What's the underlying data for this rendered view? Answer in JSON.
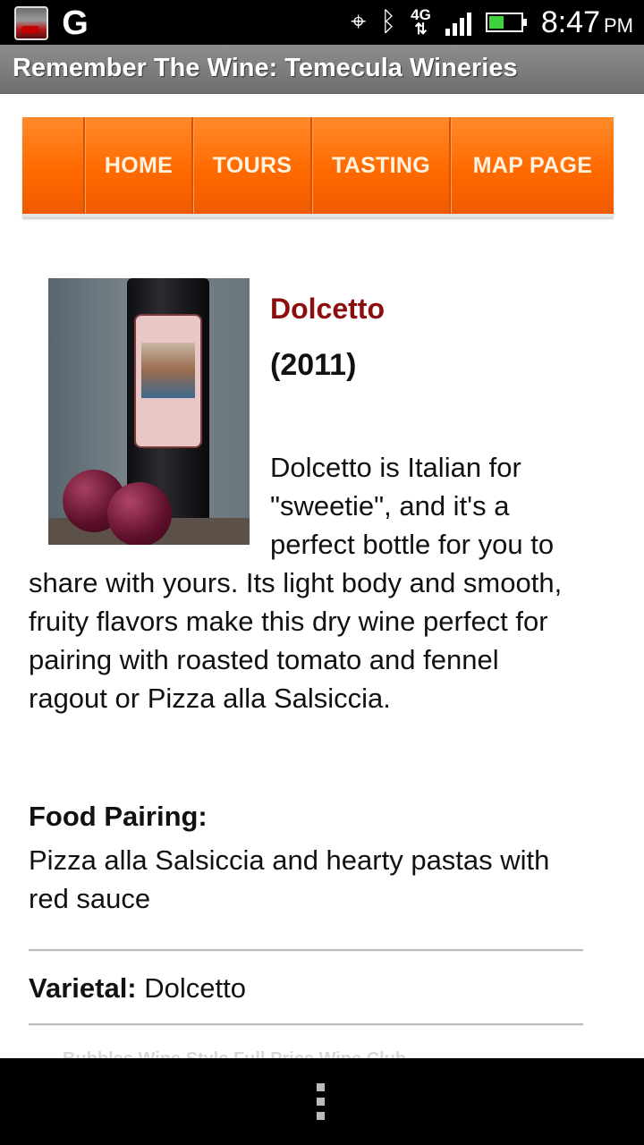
{
  "status_bar": {
    "time": "8:47",
    "ampm": "PM",
    "network": "4G",
    "icons": [
      "photo-notification-icon",
      "google-icon",
      "gps-icon",
      "bluetooth-icon",
      "network-4g-icon",
      "signal-icon",
      "battery-icon"
    ],
    "google_glyph": "G"
  },
  "app": {
    "title": "Remember The Wine: Temecula Wineries"
  },
  "nav": {
    "items": [
      {
        "label": "HOME"
      },
      {
        "label": "TOURS"
      },
      {
        "label": "TASTING"
      },
      {
        "label": "MAP PAGE"
      }
    ],
    "colors": {
      "background": "#ff6a00",
      "text": "#fff3e0"
    }
  },
  "wine": {
    "name": "Dolcetto",
    "year": "(2011)",
    "description": "Dolcetto is Italian for \"sweetie\", and it's a perfect bottle for you to share with yours. Its light body and smooth, fruity flavors make this dry wine perfect for pairing with roasted tomato and fennel ragout or Pizza alla Salsiccia.",
    "food_pairing_label": "Food Pairing:",
    "food_pairing": "Pizza alla Salsiccia and hearty pastas with red sauce",
    "varietal_label": "Varietal:",
    "varietal": "Dolcetto",
    "name_color": "#8b0d0d"
  },
  "faded_text": "Bubbles      Wine Style   Full Price   Wine Club"
}
